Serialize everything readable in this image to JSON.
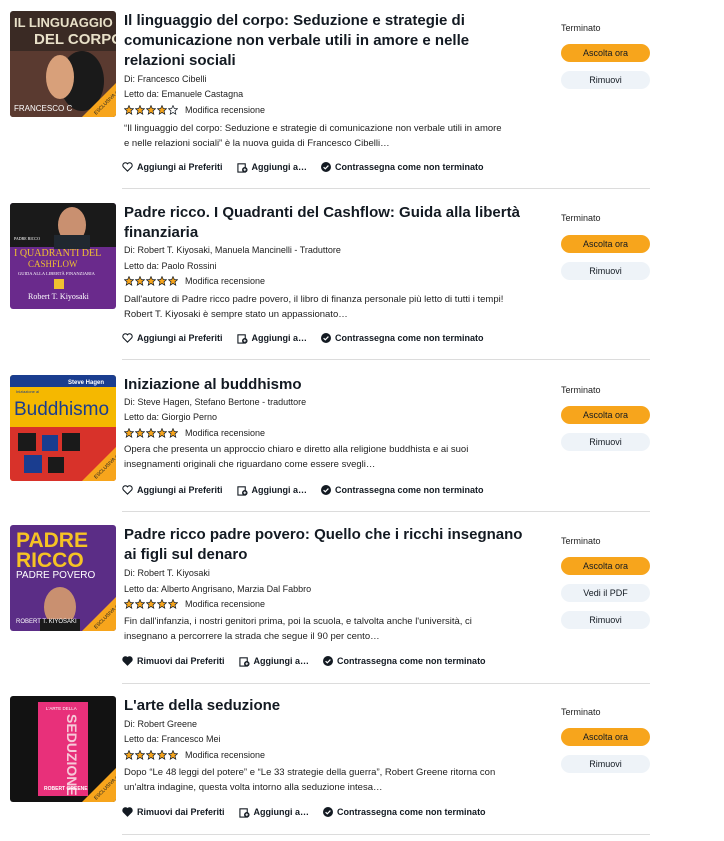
{
  "books": [
    {
      "title": "Il linguaggio del corpo: Seduzione e strategie di comunicazione non verbale utili in amore e nelle relazioni sociali",
      "author": "Di: Francesco Cibelli",
      "narrator": "Letto da: Emanuele Castagna",
      "rating": 4,
      "rating_label": "Modifica recensione",
      "summary": "“Il linguaggio del corpo: Seduzione e strategie di comunicazione non verbale utili in amore e nelle relazioni sociali” è la nuova guida di Francesco Cibelli…",
      "favorite_label": "Aggiungi ai Preferiti",
      "add_label": "Aggiungi a…",
      "mark_label": "Contrassegna come non terminato",
      "status": "Terminato",
      "listen_label": "Ascolta ora",
      "pdf_label": "",
      "remove_label": "Rimuovi",
      "cover": {
        "lines": [
          "IL LINGUAGGIO",
          "DEL CORPO"
        ],
        "author": "FRANCESCO C",
        "badge": "ESCLUSIVA audible",
        "bg": "#2b2b2b",
        "accent": "#e8e0c8"
      }
    },
    {
      "title": "Padre ricco. I Quadranti del Cashflow: Guida alla libertà finanziaria",
      "author": "Di: Robert T. Kiyosaki, Manuela Mancinelli - Traduttore",
      "narrator": "Letto da: Paolo Rossini",
      "rating": 5,
      "rating_label": "Modifica recensione",
      "summary": "Dall'autore di Padre ricco padre povero, il libro di finanza personale più letto di tutti i tempi! Robert T. Kiyosaki è sempre stato un appassionato…",
      "favorite_label": "Aggiungi ai Preferiti",
      "add_label": "Aggiungi a…",
      "mark_label": "Contrassegna come non terminato",
      "status": "Terminato",
      "listen_label": "Ascolta ora",
      "pdf_label": "",
      "remove_label": "Rimuovi",
      "cover": {
        "lines": [
          "PADRE RICCO",
          "I QUADRANTI DEL",
          "CASHFLOW",
          "GUIDA ALLA LIBERTÀ FINANZIARIA"
        ],
        "author": "Robert T. Kiyosaki",
        "badge": "",
        "bg": "#6a2a8c",
        "accent": "#f0c030"
      }
    },
    {
      "title": "Iniziazione al buddhismo",
      "author": "Di: Steve Hagen, Stefano Bertone - traduttore",
      "narrator": "Letto da: Giorgio Perno",
      "rating": 5,
      "rating_label": "Modifica recensione",
      "summary": "Opera che presenta un approccio chiaro e diretto alla religione buddhista e ai suoi insegnamenti originali che riguardano come essere svegli…",
      "favorite_label": "Aggiungi ai Preferiti",
      "add_label": "Aggiungi a…",
      "mark_label": "Contrassegna come non terminato",
      "status": "Terminato",
      "listen_label": "Ascolta ora",
      "pdf_label": "",
      "remove_label": "Rimuovi",
      "cover": {
        "lines": [
          "Iniziazione al",
          "Buddhismo"
        ],
        "author": "Steve Hagen",
        "badge": "ESCLUSIVA audible",
        "bg": "#f5b800",
        "accent": "#1a3d8f"
      }
    },
    {
      "title": "Padre ricco padre povero: Quello che i ricchi insegnano ai figli sul denaro",
      "author": "Di: Robert T. Kiyosaki",
      "narrator": "Letto da: Alberto Angrisano, Marzia Dal Fabbro",
      "rating": 5,
      "rating_label": "Modifica recensione",
      "summary": "Fin dall'infanzia, i nostri genitori prima, poi la scuola, e talvolta anche l'università, ci insegnano a percorrere la strada che segue il 90 per cento…",
      "favorite_label": "Rimuovi dai Preferiti",
      "add_label": "Aggiungi a…",
      "mark_label": "Contrassegna come non terminato",
      "status": "Terminato",
      "listen_label": "Ascolta ora",
      "pdf_label": "Vedi il PDF",
      "remove_label": "Rimuovi",
      "cover": {
        "lines": [
          "PADRE",
          "RICCO",
          "PADRE POVERO"
        ],
        "author": "ROBERT T. KIYOSAKI",
        "badge": "ESCLUSIVA audible",
        "bg": "#5b2d86",
        "accent": "#f6c324"
      }
    },
    {
      "title": "L'arte della seduzione",
      "author": "Di: Robert Greene",
      "narrator": "Letto da: Francesco Mei",
      "rating": 5,
      "rating_label": "Modifica recensione",
      "summary": "Dopo “Le 48 leggi del potere” e “Le 33 strategie della guerra”, Robert Greene ritorna con un'altra indagine, questa volta intorno alla seduzione intesa…",
      "favorite_label": "Rimuovi dai Preferiti",
      "add_label": "Aggiungi a…",
      "mark_label": "Contrassegna come non terminato",
      "status": "Terminato",
      "listen_label": "Ascolta ora",
      "pdf_label": "",
      "remove_label": "Rimuovi",
      "cover": {
        "lines": [
          "L'ARTE DELLA",
          "SEDUZIONE"
        ],
        "author": "ROBERT GREENE",
        "badge": "ESCLUSIVA audible",
        "bg": "#121212",
        "accent": "#e8307a"
      }
    }
  ]
}
